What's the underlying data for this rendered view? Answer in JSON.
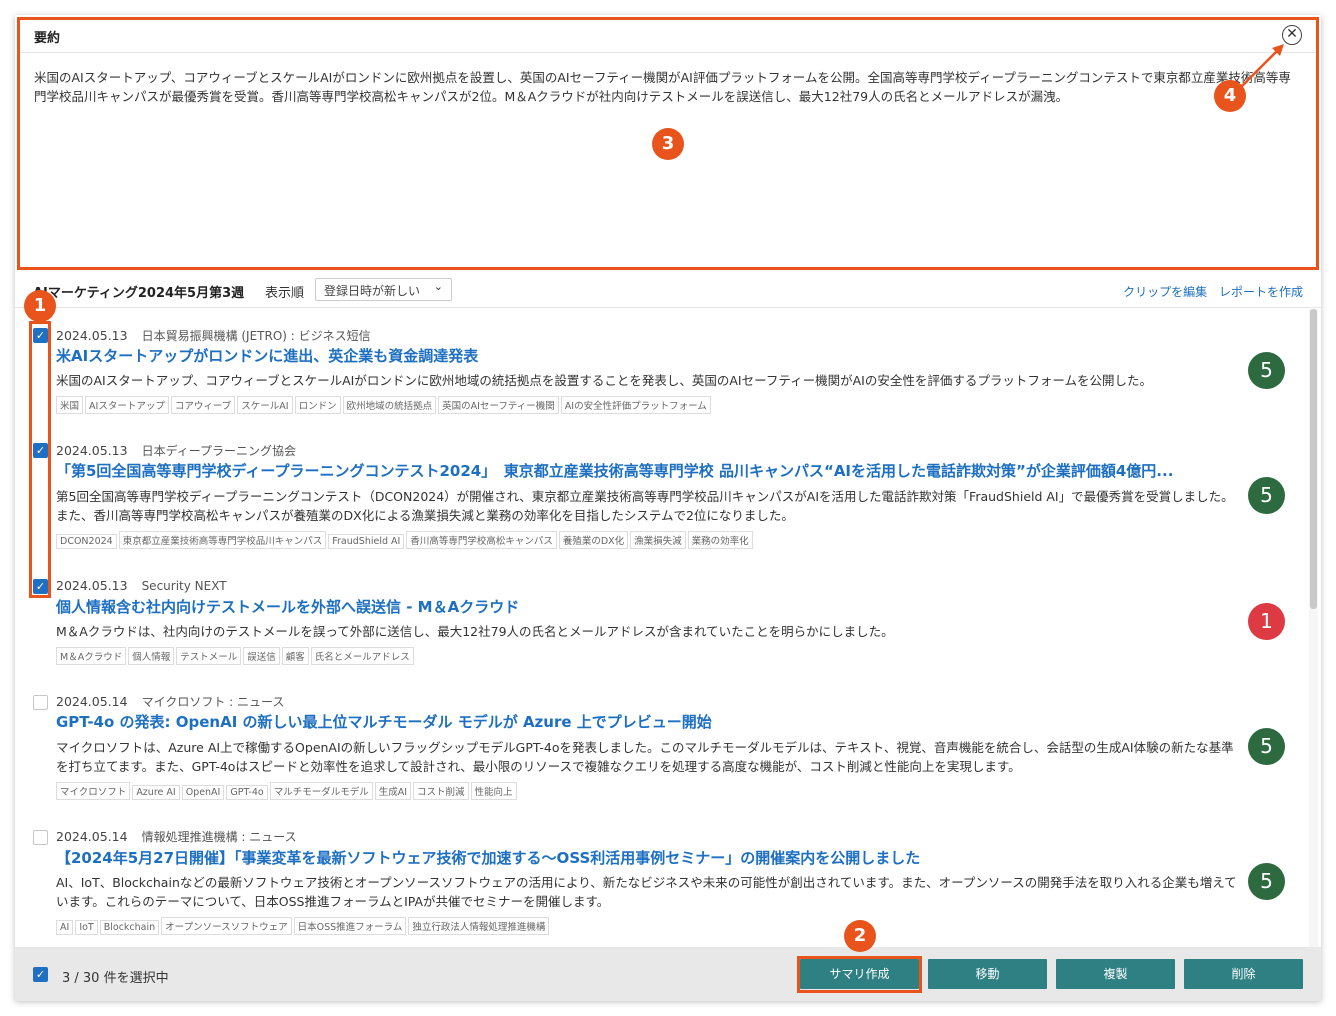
{
  "summary": {
    "header": "要約",
    "text": "米国のAIスタートアップ、コアウィーブとスケールAIがロンドンに欧州拠点を設置し、英国のAIセーフティー機関がAI評価プラットフォームを公開。全国高等専門学校ディープラーニングコンテストで東京都立産業技術高等専門学校品川キャンパスが最優秀賞を受賞。香川高等専門学校高松キャンパスが2位。M＆Aクラウドが社内向けテストメールを誤送信し、最大12社79人の氏名とメールアドレスが漏洩。"
  },
  "toolbar": {
    "clip_title": "AIマーケティング2024年5月第3週",
    "order_label": "表示順",
    "order_value": "登録日時が新しい",
    "edit_link": "クリップを編集",
    "report_link": "レポートを作成"
  },
  "items": [
    {
      "date": "2024.05.13",
      "source": "日本貿易振興機構 (JETRO) : ビジネス短信",
      "title": "米AIスタートアップがロンドンに進出、英企業も資金調達発表",
      "desc": "米国のAIスタートアップ、コアウィーブとスケールAIがロンドンに欧州地域の統括拠点を設置することを発表し、英国のAIセーフティー機関がAIの安全性を評価するプラットフォームを公開した。",
      "tags": [
        "米国",
        "AIスタートアップ",
        "コアウィーブ",
        "スケールAI",
        "ロンドン",
        "欧州地域の統括拠点",
        "英国のAIセーフティー機関",
        "AIの安全性評価プラットフォーム"
      ],
      "score": "5",
      "checked": true
    },
    {
      "date": "2024.05.13",
      "source": "日本ディープラーニング協会",
      "title": "「第5回全国高等専門学校ディープラーニングコンテスト2024」　東京都立産業技術高等専門学校 品川キャンパス“AIを活用した電話詐欺対策”が企業評価額4億円...",
      "desc": "第5回全国高等専門学校ディープラーニングコンテスト（DCON2024）が開催され、東京都立産業技術高等専門学校品川キャンパスがAIを活用した電話詐欺対策「FraudShield AI」で最優秀賞を受賞しました。また、香川高等専門学校高松キャンパスが養殖業のDX化による漁業損失減と業務の効率化を目指したシステムで2位になりました。",
      "tags": [
        "DCON2024",
        "東京都立産業技術高等専門学校品川キャンパス",
        "FraudShield AI",
        "香川高等専門学校高松キャンパス",
        "養殖業のDX化",
        "漁業損失減",
        "業務の効率化"
      ],
      "score": "5",
      "checked": true
    },
    {
      "date": "2024.05.13",
      "source": "Security NEXT",
      "title": "個人情報含む社内向けテストメールを外部へ誤送信 - M＆Aクラウド",
      "desc": "M＆Aクラウドは、社内向けのテストメールを誤って外部に送信し、最大12社79人の氏名とメールアドレスが含まれていたことを明らかにしました。",
      "tags": [
        "M＆Aクラウド",
        "個人情報",
        "テストメール",
        "誤送信",
        "顧客",
        "氏名とメールアドレス"
      ],
      "score": "1",
      "checked": true
    },
    {
      "date": "2024.05.14",
      "source": "マイクロソフト : ニュース",
      "title": "GPT-4o の発表: OpenAI の新しい最上位マルチモーダル モデルが Azure 上でプレビュー開始",
      "desc": "マイクロソフトは、Azure AI上で稼働するOpenAIの新しいフラッグシップモデルGPT-4oを発表しました。このマルチモーダルモデルは、テキスト、視覚、音声機能を統合し、会話型の生成AI体験の新たな基準を打ち立てます。また、GPT-4oはスピードと効率性を追求して設計され、最小限のリソースで複雑なクエリを処理する高度な機能が、コスト削減と性能向上を実現します。",
      "tags": [
        "マイクロソフト",
        "Azure AI",
        "OpenAI",
        "GPT-4o",
        "マルチモーダルモデル",
        "生成AI",
        "コスト削減",
        "性能向上"
      ],
      "score": "5",
      "checked": false
    },
    {
      "date": "2024.05.14",
      "source": "情報処理推進機構 : ニュース",
      "title": "【2024年5月27日開催】「事業変革を最新ソフトウェア技術で加速する～OSS利活用事例セミナー」の開催案内を公開しました",
      "desc": "AI、IoT、Blockchainなどの最新ソフトウェア技術とオープンソースソフトウェアの活用により、新たなビジネスや未来の可能性が創出されています。また、オープンソースの開発手法を取り入れる企業も増えています。これらのテーマについて、日本OSS推進フォーラムとIPAが共催でセミナーを開催します。",
      "tags": [
        "AI",
        "IoT",
        "Blockchain",
        "オープンソースソフトウェア",
        "日本OSS推進フォーラム",
        "独立行政法人情報処理推進機構"
      ],
      "score": "5",
      "checked": false
    }
  ],
  "footer": {
    "count": "3 / 30 件を選択中",
    "summary_btn": "サマリ作成",
    "move_btn": "移動",
    "copy_btn": "複製",
    "delete_btn": "削除"
  },
  "annotations": [
    "1",
    "2",
    "3",
    "4"
  ],
  "colors": {
    "accent": "#e8541c",
    "link": "#1d6fc2",
    "button": "#2e8083",
    "score_good": "#2d6a3f",
    "score_bad": "#dd3a44"
  }
}
